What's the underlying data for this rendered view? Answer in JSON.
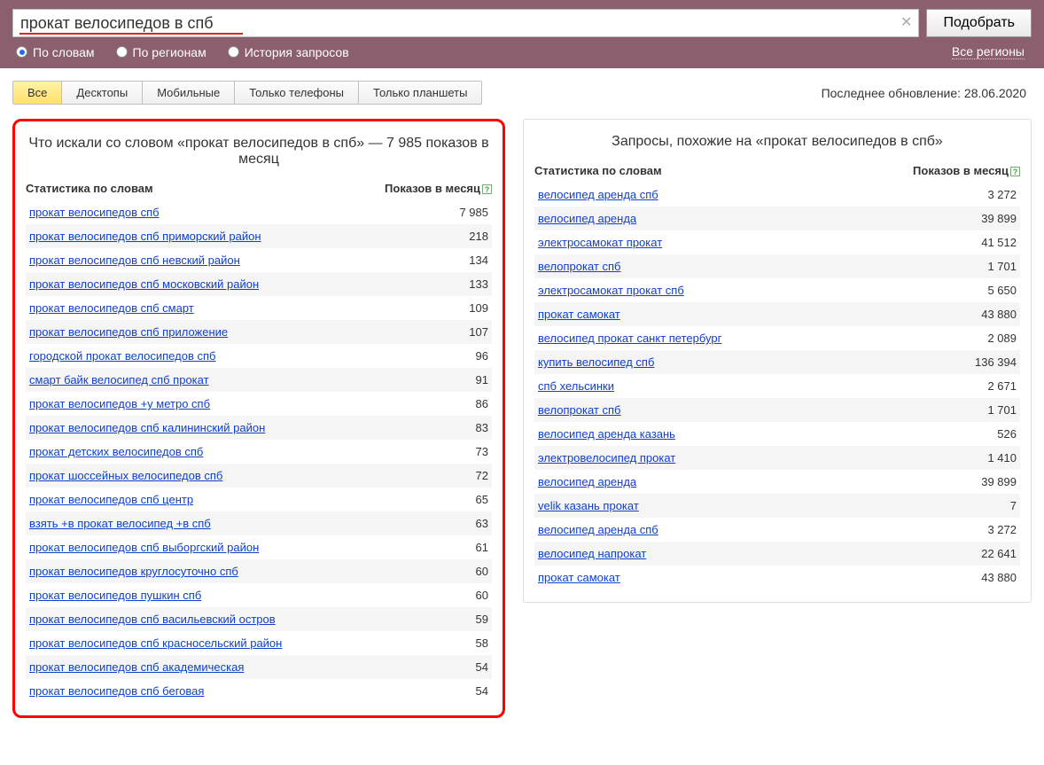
{
  "search": {
    "value": "прокат велосипедов в спб",
    "button": "Подобрать",
    "clear_glyph": "✕"
  },
  "radios": {
    "by_words": "По словам",
    "by_regions": "По регионам",
    "history": "История запросов",
    "selected": "by_words"
  },
  "all_regions": "Все регионы",
  "tabs": {
    "items": [
      "Все",
      "Десктопы",
      "Мобильные",
      "Только телефоны",
      "Только планшеты"
    ],
    "active_index": 0
  },
  "last_update": "Последнее обновление: 28.06.2020",
  "left_panel": {
    "title": "Что искали со словом «прокат велосипедов в спб» — 7 985 показов в месяц",
    "col_query": "Статистика по словам",
    "col_count": "Показов в месяц",
    "rows": [
      {
        "q": "прокат велосипедов спб",
        "v": "7 985"
      },
      {
        "q": "прокат велосипедов спб приморский район",
        "v": "218"
      },
      {
        "q": "прокат велосипедов спб невский район",
        "v": "134"
      },
      {
        "q": "прокат велосипедов спб московский район",
        "v": "133"
      },
      {
        "q": "прокат велосипедов спб смарт",
        "v": "109"
      },
      {
        "q": "прокат велосипедов спб приложение",
        "v": "107"
      },
      {
        "q": "городской прокат велосипедов спб",
        "v": "96"
      },
      {
        "q": "смарт байк велосипед спб прокат",
        "v": "91"
      },
      {
        "q": "прокат велосипедов +у метро спб",
        "v": "86"
      },
      {
        "q": "прокат велосипедов спб калининский район",
        "v": "83"
      },
      {
        "q": "прокат детских велосипедов спб",
        "v": "73"
      },
      {
        "q": "прокат шоссейных велосипедов спб",
        "v": "72"
      },
      {
        "q": "прокат велосипедов спб центр",
        "v": "65"
      },
      {
        "q": "взять +в прокат велосипед +в спб",
        "v": "63"
      },
      {
        "q": "прокат велосипедов спб выборгский район",
        "v": "61"
      },
      {
        "q": "прокат велосипедов круглосуточно спб",
        "v": "60"
      },
      {
        "q": "прокат велосипедов пушкин спб",
        "v": "60"
      },
      {
        "q": "прокат велосипедов спб васильевский остров",
        "v": "59"
      },
      {
        "q": "прокат велосипедов спб красносельский район",
        "v": "58"
      },
      {
        "q": "прокат велосипедов спб академическая",
        "v": "54"
      },
      {
        "q": "прокат велосипедов спб беговая",
        "v": "54"
      }
    ]
  },
  "right_panel": {
    "title": "Запросы, похожие на «прокат велосипедов в спб»",
    "col_query": "Статистика по словам",
    "col_count": "Показов в месяц",
    "rows": [
      {
        "q": "велосипед аренда спб",
        "v": "3 272"
      },
      {
        "q": "велосипед аренда",
        "v": "39 899"
      },
      {
        "q": "электросамокат прокат",
        "v": "41 512"
      },
      {
        "q": "велопрокат спб",
        "v": "1 701"
      },
      {
        "q": "электросамокат прокат спб",
        "v": "5 650"
      },
      {
        "q": "прокат самокат",
        "v": "43 880"
      },
      {
        "q": "велосипед прокат санкт петербург",
        "v": "2 089"
      },
      {
        "q": "купить велосипед спб",
        "v": "136 394"
      },
      {
        "q": "спб хельсинки",
        "v": "2 671"
      },
      {
        "q": "велопрокат спб",
        "v": "1 701"
      },
      {
        "q": "велосипед аренда казань",
        "v": "526"
      },
      {
        "q": "электровелосипед прокат",
        "v": "1 410"
      },
      {
        "q": "велосипед аренда",
        "v": "39 899"
      },
      {
        "q": "velik казань прокат",
        "v": "7"
      },
      {
        "q": "велосипед аренда спб",
        "v": "3 272"
      },
      {
        "q": "велосипед напрокат",
        "v": "22 641"
      },
      {
        "q": "прокат самокат",
        "v": "43 880"
      }
    ]
  }
}
